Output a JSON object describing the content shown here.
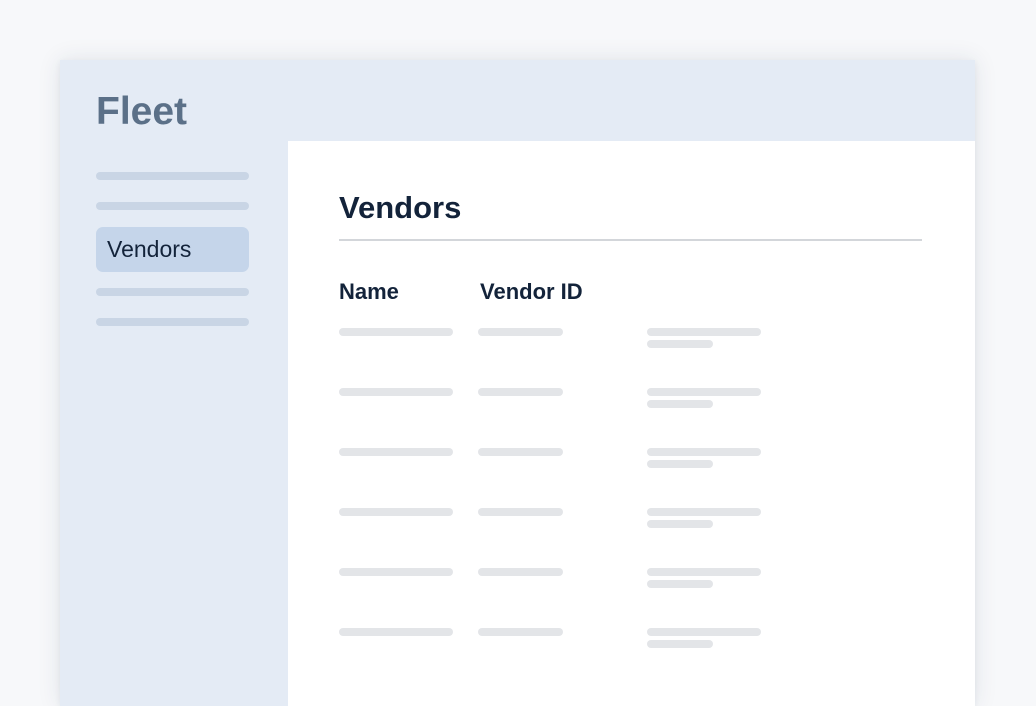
{
  "app": {
    "title": "Fleet"
  },
  "sidebar": {
    "items": [
      {
        "label": "",
        "placeholder": true
      },
      {
        "label": "",
        "placeholder": true
      },
      {
        "label": "Vendors",
        "active": true
      },
      {
        "label": "",
        "placeholder": true
      },
      {
        "label": "",
        "placeholder": true
      }
    ]
  },
  "main": {
    "title": "Vendors",
    "table": {
      "columns": [
        "Name",
        "Vendor ID",
        ""
      ],
      "row_count": 6,
      "rows": [
        {
          "name": "",
          "vendor_id": "",
          "details": ""
        },
        {
          "name": "",
          "vendor_id": "",
          "details": ""
        },
        {
          "name": "",
          "vendor_id": "",
          "details": ""
        },
        {
          "name": "",
          "vendor_id": "",
          "details": ""
        },
        {
          "name": "",
          "vendor_id": "",
          "details": ""
        },
        {
          "name": "",
          "vendor_id": "",
          "details": ""
        }
      ]
    }
  },
  "colors": {
    "window_bg": "#e4ebf5",
    "active_nav_bg": "#c5d5ea",
    "text_primary": "#13233a",
    "app_title": "#5b7088",
    "placeholder": "#e3e5e8",
    "nav_placeholder": "#c9d5e5"
  }
}
